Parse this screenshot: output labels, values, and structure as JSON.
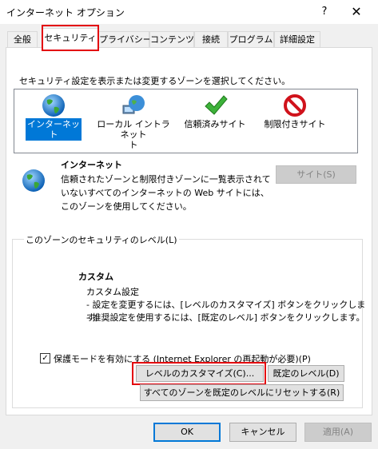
{
  "window": {
    "title": "インターネット オプション",
    "help_label": "?",
    "close_label": "✕"
  },
  "tabs": [
    {
      "label": "全般"
    },
    {
      "label": "セキュリティ",
      "active": true
    },
    {
      "label": "プライバシー"
    },
    {
      "label": "コンテンツ"
    },
    {
      "label": "接続"
    },
    {
      "label": "プログラム"
    },
    {
      "label": "詳細設定"
    }
  ],
  "security": {
    "zone_prompt": "セキュリティ設定を表示または変更するゾーンを選択してください。",
    "zones": [
      {
        "label": "インターネット",
        "icon": "globe-icon",
        "selected": true
      },
      {
        "label": "ローカル イントラネット\nト",
        "icon": "intranet-globe-icon"
      },
      {
        "label": "信頼済みサイト",
        "icon": "checkmark-icon"
      },
      {
        "label": "制限付きサイト",
        "icon": "prohibited-icon"
      }
    ],
    "zone_title": "インターネット",
    "zone_description": "信頼されたゾーンと制限付きゾーンに一覧表示されていないすべてのインターネットの Web サイトには、このゾーンを使用してください。",
    "sites_button": "サイト(S)",
    "group_legend": "このゾーンのセキュリティのレベル(L)",
    "level_title": "カスタム",
    "level_subtitle": "カスタム設定",
    "level_line1": "- 設定を変更するには、[レベルのカスタマイズ] ボタンをクリックします。",
    "level_line2": "- 推奨設定を使用するには、[既定のレベル] ボタンをクリックします。",
    "protected_mode_label": "保護モードを有効にする (Internet Explorer の再起動が必要)(P)",
    "protected_mode_checked": true,
    "custom_level_button": "レベルのカスタマイズ(C)...",
    "default_level_button": "既定のレベル(D)",
    "reset_all_button": "すべてのゾーンを既定のレベルにリセットする(R)"
  },
  "footer": {
    "ok": "OK",
    "cancel": "キャンセル",
    "apply": "適用(A)"
  },
  "colors": {
    "highlight_red": "#e3000b",
    "selection_blue": "#0078d7"
  }
}
